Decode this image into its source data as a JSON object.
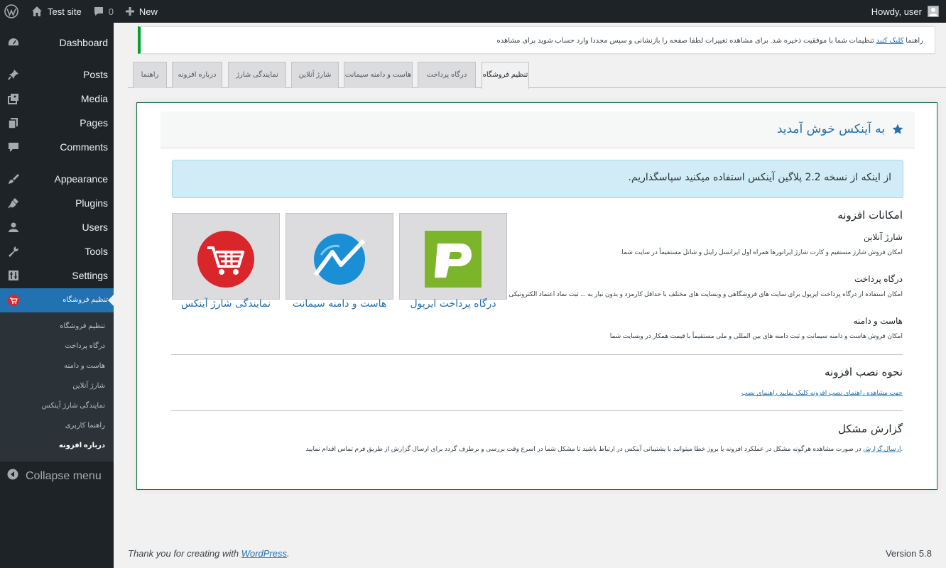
{
  "adminbar": {
    "site_name": "Test site",
    "comments_count": "0",
    "new_label": "New",
    "howdy": "Howdy, user"
  },
  "sidebar": {
    "items": [
      {
        "label": "Dashboard",
        "icon": "dashboard-icon"
      },
      {
        "label": "Posts",
        "icon": "pin-icon"
      },
      {
        "label": "Media",
        "icon": "media-icon"
      },
      {
        "label": "Pages",
        "icon": "pages-icon"
      },
      {
        "label": "Comments",
        "icon": "comment-icon"
      },
      {
        "label": "Appearance",
        "icon": "brush-icon"
      },
      {
        "label": "Plugins",
        "icon": "plugin-icon"
      },
      {
        "label": "Users",
        "icon": "user-icon"
      },
      {
        "label": "Tools",
        "icon": "wrench-icon"
      },
      {
        "label": "Settings",
        "icon": "settings-icon"
      },
      {
        "label": "تنظیم فروشگاه",
        "icon": "cart-icon"
      }
    ],
    "submenu": [
      "تنظیم فروشگاه",
      "درگاه پرداخت",
      "هاست و دامنه",
      "شارژ آنلاین",
      "نمایندگی شارژ آینکس",
      "راهنما کاربری",
      "درباره افزونه"
    ],
    "collapse_label": "Collapse menu"
  },
  "notice": {
    "text_before": "تنظیمات شما با موفقیت ذخیره شد. برای مشاهده تغییرات لطفا صفحه را بازنشانی و سپس مجددا وارد حساب شوید برای مشاهده",
    "link": "کلیک کنید",
    "text_after": "راهنما"
  },
  "tabs": [
    "راهنما",
    "درباره افزونه",
    "نمایندگی شارژ",
    "شارژ آنلاین",
    "هاست و دامنه سیمانت",
    "درگاه پرداخت",
    "تنظیم فروشگاه"
  ],
  "panel": {
    "title": "به آینکس خوش آمدید",
    "info": ".از اینکه از نسخه 2.2 پلاگین آینکس استفاده میکنید سپاسگذاریم",
    "features_title": "امکانات افزونه",
    "features": [
      {
        "title": "شارژ آنلاین",
        "desc": "امکان فروش شارژ مستقیم و کارت شارژ اپراتورها همراه اول ایرانسل رایتل و شاتل مستقیماً در سایت شما"
      },
      {
        "title": "درگاه پرداخت",
        "desc": "امکان استفاده از درگاه پرداخت ایرپول برای سایت های فروشگاهی و وبسایت های مختلف با حداقل کارمزد و بدون نیاز به ... ثبت نماد اعتماد الکترونیکی"
      },
      {
        "title": "هاست و دامنه",
        "desc": "امکان فروش هاست و دامنه سیمانت و ثبت دامنه های بین المللی و ملی مستقیماً با قیمت همکار در وبسایت شما"
      }
    ],
    "install_title": "نحوه نصب افزونه",
    "install_link": "جهت مشاهده راهنمای نصب افزونه کلیک نمایید راهنمای نصب",
    "report_title": "گزارش مشکل",
    "report_text": "در صورت مشاهده هرگونه مشکل در عملکرد افزونه یا بروز خطا میتوانید با پشتیبانی آینکس در ارتباط باشید تا مشکل شما در اسرع وقت بررسی و برطرف گردد برای ارسال گزارش از طریق فرم تماس اقدام نمایید.",
    "report_link": "ارسال گزارش",
    "cards": [
      {
        "label": "درگاه پرداخت ایرپول",
        "icon": "irpool-logo-icon",
        "color": "#7cb52a"
      },
      {
        "label": "هاست و دامنه سیمانت",
        "icon": "simant-logo-icon",
        "color": "#1a8fd6"
      },
      {
        "label": "نمایندگی شارژ آینکس",
        "icon": "cart-logo-icon",
        "color": "#d9262a"
      }
    ]
  },
  "footer": {
    "thanks": "Thank you for creating with ",
    "wp_link": "WordPress",
    "period": ".",
    "version": "Version 5.8"
  }
}
